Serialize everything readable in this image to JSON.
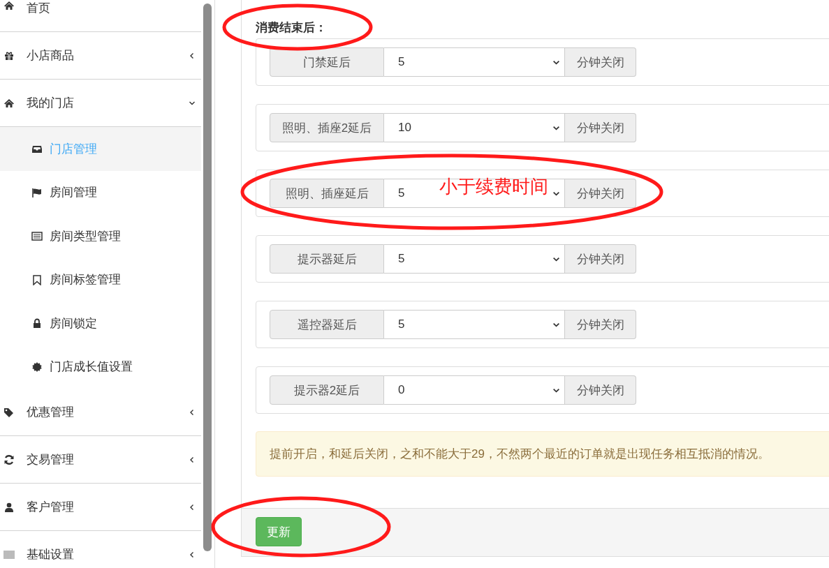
{
  "sidebar": {
    "items": [
      {
        "label": "首页"
      },
      {
        "label": "小店商品",
        "expanded": false
      },
      {
        "label": "我的门店",
        "expanded": true,
        "children": [
          {
            "label": "门店管理",
            "selected": true
          },
          {
            "label": "房间管理",
            "selected": false
          },
          {
            "label": "房间类型管理",
            "selected": false
          },
          {
            "label": "房间标签管理",
            "selected": false
          },
          {
            "label": "房间锁定",
            "selected": false
          },
          {
            "label": "门店成长值设置",
            "selected": false
          }
        ]
      },
      {
        "label": "优惠管理",
        "expanded": false
      },
      {
        "label": "交易管理",
        "expanded": false
      },
      {
        "label": "客户管理",
        "expanded": false
      },
      {
        "label": "基础设置",
        "expanded": false
      }
    ]
  },
  "form": {
    "heading": "消费结束后：",
    "delays": [
      {
        "label": "门禁延后",
        "value": "5",
        "unit": "分钟关闭"
      },
      {
        "label": "照明、插座2延后",
        "value": "10",
        "unit": "分钟关闭"
      },
      {
        "label": "照明、插座延后",
        "value": "5",
        "unit": "分钟关闭"
      },
      {
        "label": "提示器延后",
        "value": "5",
        "unit": "分钟关闭"
      },
      {
        "label": "遥控器延后",
        "value": "5",
        "unit": "分钟关闭"
      },
      {
        "label": "提示器2延后",
        "value": "0",
        "unit": "分钟关闭"
      }
    ],
    "notice": "提前开启，和延后关闭，之和不能大于29，不然两个最近的订单就是出现任务相互抵消的情况。",
    "submit": "更新"
  },
  "annotation": {
    "note": "小于续费时间"
  }
}
